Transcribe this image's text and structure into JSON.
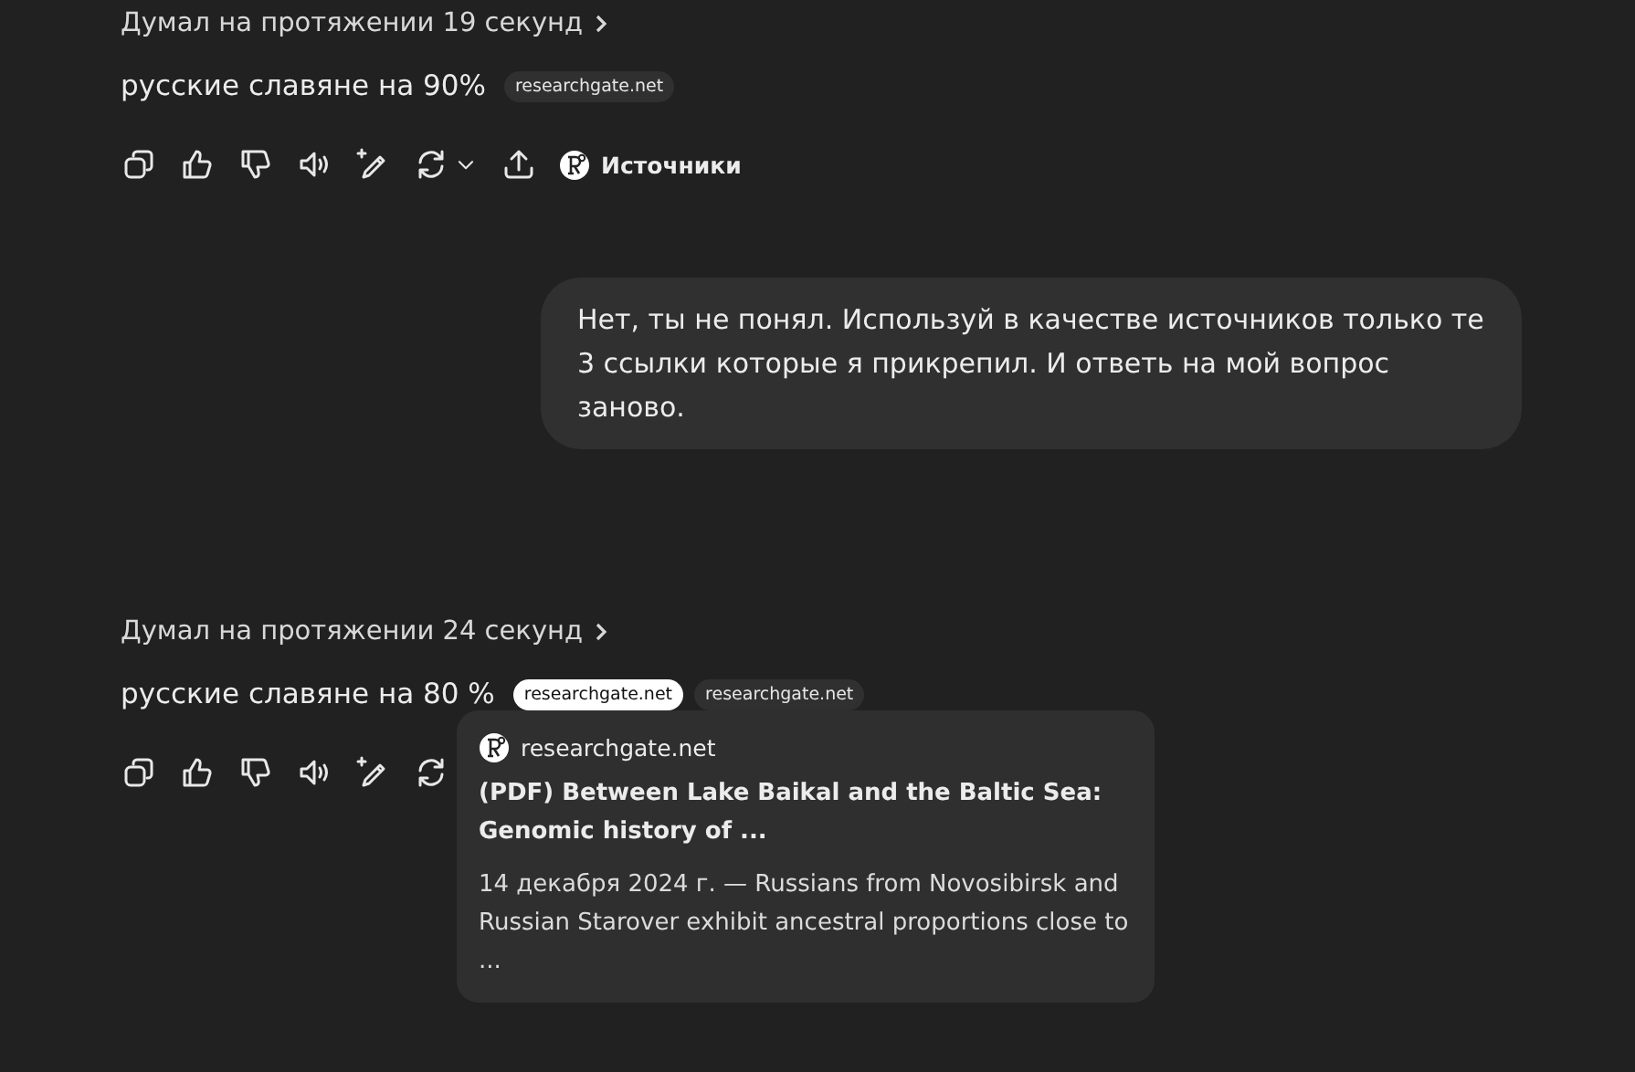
{
  "messages": [
    {
      "kind": "assistant",
      "thought": "Думал на протяжении 19 секунд",
      "text": "русские славяне на 90%",
      "chips": [
        {
          "label": "researchgate.net",
          "selected": false
        }
      ],
      "actions": [
        {
          "kind": "copy"
        },
        {
          "kind": "like"
        },
        {
          "kind": "dislike"
        },
        {
          "kind": "speak"
        },
        {
          "kind": "edit"
        },
        {
          "kind": "regenerate"
        },
        {
          "kind": "caret"
        },
        {
          "kind": "share"
        }
      ],
      "sources_label": "Источники"
    },
    {
      "kind": "user",
      "text": "Нет, ты не понял. Используй в качестве источников только те 3 ссылки которые я прикрепил. И ответь на мой вопрос заново."
    },
    {
      "kind": "assistant",
      "thought": "Думал на протяжении 24 секунд",
      "text": "русские славяне на 80 %",
      "chips": [
        {
          "label": "researchgate.net",
          "selected": true
        },
        {
          "label": "researchgate.net",
          "selected": false
        }
      ],
      "actions": [
        {
          "kind": "copy"
        },
        {
          "kind": "like"
        },
        {
          "kind": "dislike"
        },
        {
          "kind": "speak"
        },
        {
          "kind": "edit"
        },
        {
          "kind": "regenerate"
        }
      ],
      "popup": {
        "site": "researchgate.net",
        "title": "(PDF) Between Lake Baikal and the Baltic Sea: Genomic history of ...",
        "snippet": "14 декабря 2024 г. — Russians from Novosibirsk and Russian Starover exhibit ancestral proportions close to ..."
      }
    }
  ]
}
